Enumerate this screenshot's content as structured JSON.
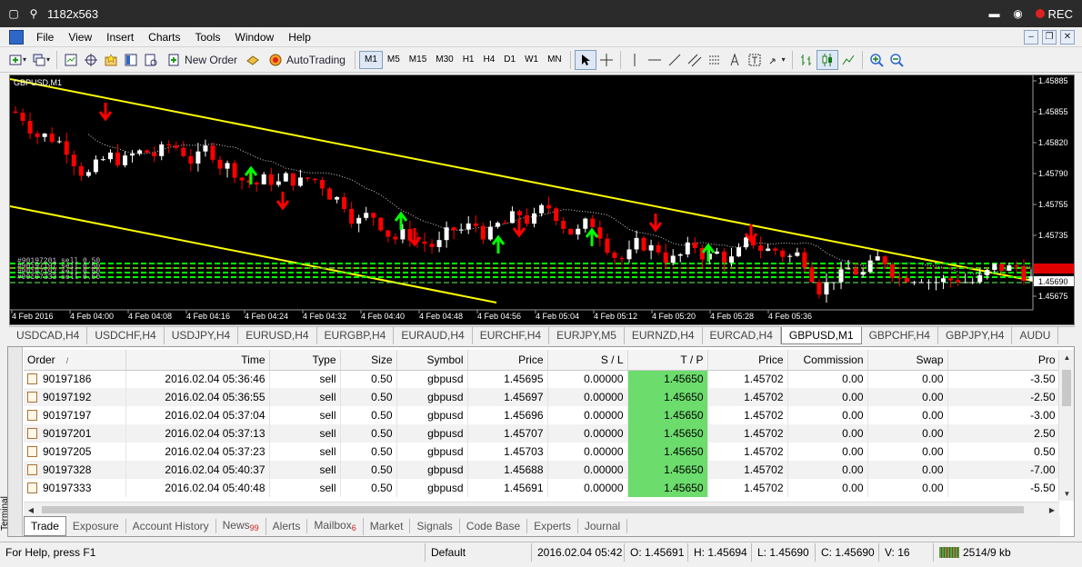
{
  "window": {
    "title": "1182x563",
    "rec_label": "REC"
  },
  "menu": [
    "File",
    "View",
    "Insert",
    "Charts",
    "Tools",
    "Window",
    "Help"
  ],
  "toolbar": {
    "new_order": "New Order",
    "autotrading": "AutoTrading",
    "timeframes": [
      "M1",
      "M5",
      "M15",
      "M30",
      "H1",
      "H4",
      "D1",
      "W1",
      "MN"
    ],
    "active_timeframe": "M1"
  },
  "chart": {
    "title": "GBPUSD,M1",
    "price_axis": [
      "1.45885",
      "1.45855",
      "1.45820",
      "1.45790",
      "1.45755",
      "1.45735",
      "1.45690",
      "1.45675"
    ],
    "current_price": "1.45690",
    "time_axis": [
      "4 Feb 2016",
      "4 Feb 04:00",
      "4 Feb 04:08",
      "4 Feb 04:16",
      "4 Feb 04:24",
      "4 Feb 04:32",
      "4 Feb 04:40",
      "4 Feb 04:48",
      "4 Feb 04:56",
      "4 Feb 05:04",
      "4 Feb 05:12",
      "4 Feb 05:20",
      "4 Feb 05:28",
      "4 Feb 05:36"
    ],
    "order_labels": [
      "#90197201 sell 0.50",
      "#90197197 sell 0.50",
      "#90197192 sell 0.50",
      "#90197333 sell 0.50"
    ],
    "colors": {
      "background": "#000000",
      "bull": "#ffffff",
      "bear": "#ff0000",
      "channel": "#ffff00",
      "tp_line": "#00ff00",
      "buy_arrow": "#00ff00",
      "sell_arrow": "#ff0000"
    }
  },
  "chart_tabs": {
    "items": [
      "USDCAD,H4",
      "USDCHF,H4",
      "USDJPY,H4",
      "EURUSD,H4",
      "EURGBP,H4",
      "EURAUD,H4",
      "EURCHF,H4",
      "EURJPY,M5",
      "EURNZD,H4",
      "EURCAD,H4",
      "GBPUSD,M1",
      "GBPCHF,H4",
      "GBPJPY,H4",
      "AUDU"
    ],
    "active_index": 10
  },
  "terminal": {
    "side_label": "Terminal",
    "columns": [
      "Order",
      "Time",
      "Type",
      "Size",
      "Symbol",
      "Price",
      "S / L",
      "T / P",
      "Price",
      "Commission",
      "Swap",
      "Pro"
    ],
    "sort_marker": "/",
    "rows": [
      [
        "90197186",
        "2016.02.04 05:36:46",
        "sell",
        "0.50",
        "gbpusd",
        "1.45695",
        "0.00000",
        "1.45650",
        "1.45702",
        "0.00",
        "0.00",
        "-3.50"
      ],
      [
        "90197192",
        "2016.02.04 05:36:55",
        "sell",
        "0.50",
        "gbpusd",
        "1.45697",
        "0.00000",
        "1.45650",
        "1.45702",
        "0.00",
        "0.00",
        "-2.50"
      ],
      [
        "90197197",
        "2016.02.04 05:37:04",
        "sell",
        "0.50",
        "gbpusd",
        "1.45696",
        "0.00000",
        "1.45650",
        "1.45702",
        "0.00",
        "0.00",
        "-3.00"
      ],
      [
        "90197201",
        "2016.02.04 05:37:13",
        "sell",
        "0.50",
        "gbpusd",
        "1.45707",
        "0.00000",
        "1.45650",
        "1.45702",
        "0.00",
        "0.00",
        "2.50"
      ],
      [
        "90197205",
        "2016.02.04 05:37:23",
        "sell",
        "0.50",
        "gbpusd",
        "1.45703",
        "0.00000",
        "1.45650",
        "1.45702",
        "0.00",
        "0.00",
        "0.50"
      ],
      [
        "90197328",
        "2016.02.04 05:40:37",
        "sell",
        "0.50",
        "gbpusd",
        "1.45688",
        "0.00000",
        "1.45650",
        "1.45702",
        "0.00",
        "0.00",
        "-7.00"
      ],
      [
        "90197333",
        "2016.02.04 05:40:48",
        "sell",
        "0.50",
        "gbpusd",
        "1.45691",
        "0.00000",
        "1.45650",
        "1.45702",
        "0.00",
        "0.00",
        "-5.50"
      ]
    ],
    "tabs": [
      {
        "label": "Trade",
        "badge": ""
      },
      {
        "label": "Exposure",
        "badge": ""
      },
      {
        "label": "Account History",
        "badge": ""
      },
      {
        "label": "News",
        "badge": "99"
      },
      {
        "label": "Alerts",
        "badge": ""
      },
      {
        "label": "Mailbox",
        "badge": "6"
      },
      {
        "label": "Market",
        "badge": ""
      },
      {
        "label": "Signals",
        "badge": ""
      },
      {
        "label": "Code Base",
        "badge": ""
      },
      {
        "label": "Experts",
        "badge": ""
      },
      {
        "label": "Journal",
        "badge": ""
      }
    ],
    "active_tab": 0
  },
  "statusbar": {
    "help": "For Help, press F1",
    "profile": "Default",
    "datetime": "2016.02.04 05:42",
    "open": "O: 1.45691",
    "high": "H: 1.45694",
    "low": "L: 1.45690",
    "close": "C: 1.45690",
    "volume": "V: 16",
    "connection": "2514/9 kb"
  }
}
